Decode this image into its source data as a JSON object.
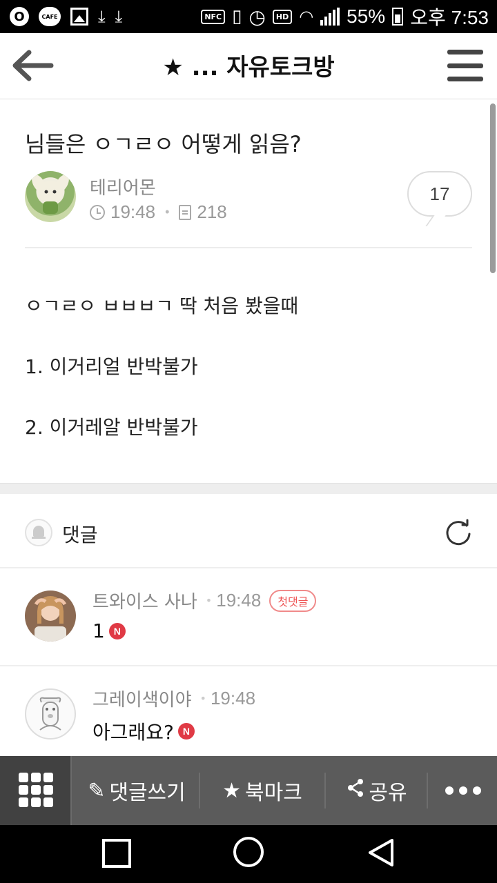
{
  "status_bar": {
    "nfc": "NFC",
    "hd": "HD",
    "battery": "55%",
    "time": "오후 7:53",
    "cafe_badge": "CAFE"
  },
  "header": {
    "title": "★ ... 자유토크방"
  },
  "post": {
    "title": "님들은 ㅇㄱㄹㅇ 어떻게 읽음?",
    "author": "테리어몬",
    "time": "19:48",
    "views": "218",
    "comment_count": "17",
    "body": [
      "ㅇㄱㄹㅇ ㅂㅂㅂㄱ 딱 처음 봤을때",
      "1. 이거리얼 반박불가",
      "2. 이거레알 반박불가"
    ]
  },
  "comments_section": {
    "label": "댓글",
    "items": [
      {
        "author": "트와이스 사나",
        "time": "19:48",
        "badge": "첫댓글",
        "text": "1",
        "new": "N"
      },
      {
        "author": "그레이색이야",
        "time": "19:48",
        "text": "아그래요?",
        "new": "N"
      }
    ]
  },
  "action_bar": {
    "write_comment": "댓글쓰기",
    "bookmark": "북마크",
    "share": "공유"
  }
}
